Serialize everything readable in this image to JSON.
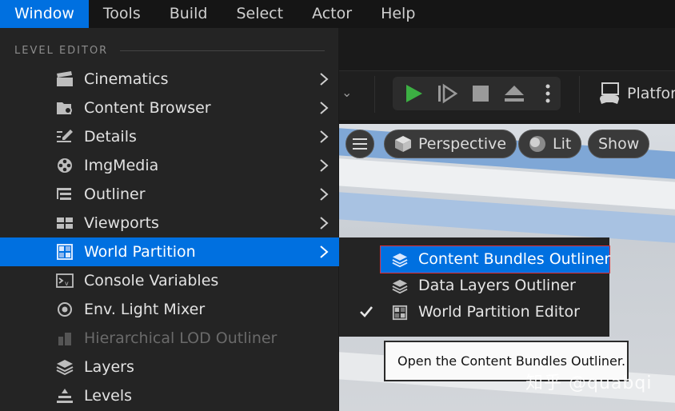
{
  "menubar": {
    "items": [
      "Window",
      "Tools",
      "Build",
      "Select",
      "Actor",
      "Help"
    ],
    "active": "Window"
  },
  "dropdown": {
    "section_label": "LEVEL EDITOR",
    "items": [
      {
        "label": "Cinematics",
        "icon": "clapperboard-icon",
        "has_submenu": true
      },
      {
        "label": "Content Browser",
        "icon": "folder-search-icon",
        "has_submenu": true
      },
      {
        "label": "Details",
        "icon": "pencil-list-icon",
        "has_submenu": true
      },
      {
        "label": "ImgMedia",
        "icon": "film-reel-icon",
        "has_submenu": true
      },
      {
        "label": "Outliner",
        "icon": "outliner-tree-icon",
        "has_submenu": true
      },
      {
        "label": "Viewports",
        "icon": "viewport-grid-icon",
        "has_submenu": true
      },
      {
        "label": "World Partition",
        "icon": "world-partition-grid-icon",
        "has_submenu": true,
        "highlighted": true
      },
      {
        "label": "Console Variables",
        "icon": "console-icon",
        "has_submenu": false
      },
      {
        "label": "Env. Light Mixer",
        "icon": "light-mixer-icon",
        "has_submenu": false
      },
      {
        "label": "Hierarchical LOD Outliner",
        "icon": "hlod-icon",
        "has_submenu": false,
        "disabled": true
      },
      {
        "label": "Layers",
        "icon": "layers-icon",
        "has_submenu": false
      },
      {
        "label": "Levels",
        "icon": "levels-icon",
        "has_submenu": false
      }
    ]
  },
  "submenu": {
    "items": [
      {
        "label": "Content Bundles Outliner",
        "icon": "layers-stack-icon",
        "highlighted": true,
        "checked": false
      },
      {
        "label": "Data Layers Outliner",
        "icon": "layers-stack-icon",
        "highlighted": false,
        "checked": false
      },
      {
        "label": "World Partition Editor",
        "icon": "world-partition-grid-icon",
        "highlighted": false,
        "checked": true
      }
    ]
  },
  "tooltip": {
    "text": "Open the Content Bundles Outliner."
  },
  "toolbar": {
    "platform_label": "Platfor"
  },
  "viewport": {
    "perspective_label": "Perspective",
    "lit_label": "Lit",
    "show_label": "Show"
  },
  "watermark": {
    "text": "知乎 @quabqi"
  },
  "colors": {
    "accent": "#0070e0",
    "menu_bg": "#242424",
    "play_green": "#3cb043",
    "highlight_outline": "#e0303a"
  }
}
